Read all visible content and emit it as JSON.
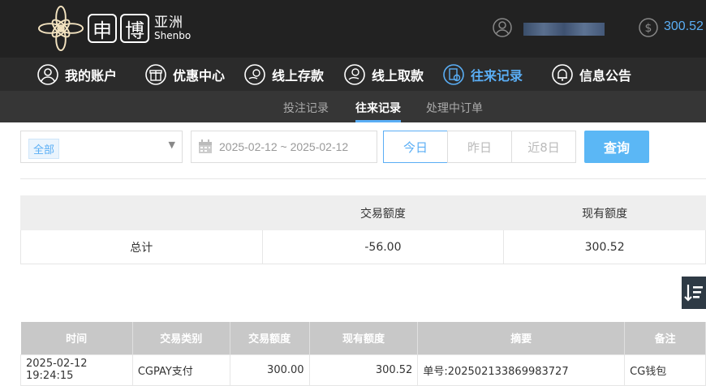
{
  "header": {
    "logo_char1": "申",
    "logo_char2": "博",
    "logo_sub_cn": "亚洲",
    "logo_sub_en": "Shenbo",
    "balance": "300.52",
    "accent_color": "#5aaef5"
  },
  "nav": {
    "items": [
      {
        "label": "我的账户",
        "icon": "user-icon"
      },
      {
        "label": "优惠中心",
        "icon": "gift-icon"
      },
      {
        "label": "线上存款",
        "icon": "deposit-icon"
      },
      {
        "label": "线上取款",
        "icon": "withdraw-icon"
      },
      {
        "label": "往来记录",
        "icon": "records-icon",
        "active": true
      },
      {
        "label": "信息公告",
        "icon": "bell-icon"
      }
    ]
  },
  "subnav": {
    "items": [
      {
        "label": "投注记录"
      },
      {
        "label": "往来记录",
        "active": true
      },
      {
        "label": "处理中订单"
      }
    ]
  },
  "filters": {
    "type_selected": "全部",
    "date_range": "2025-02-12 ~ 2025-02-12",
    "today": "今日",
    "yesterday": "昨日",
    "last8": "近8日",
    "query": "查询"
  },
  "summary": {
    "headers": [
      "",
      "交易额度",
      "现有额度"
    ],
    "total_label": "总计",
    "total_amount": "-56.00",
    "total_balance": "300.52"
  },
  "detail": {
    "headers": [
      "时间",
      "交易类别",
      "交易额度",
      "现有额度",
      "摘要",
      "备注"
    ],
    "rows": [
      {
        "time": "2025-02-12 19:24:15",
        "type": "CGPAY支付",
        "amount": "300.00",
        "balance": "300.52",
        "summary": "单号:202502133869983727",
        "remark": "CG钱包"
      }
    ]
  }
}
